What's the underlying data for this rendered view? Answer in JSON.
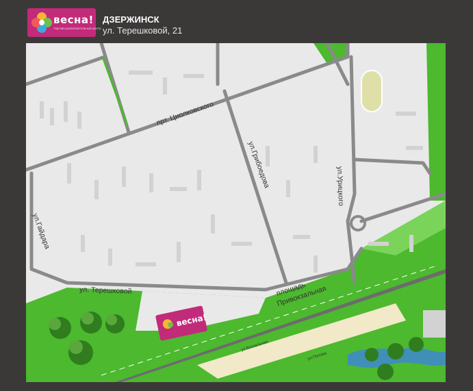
{
  "header": {
    "logo_text": "весна!",
    "logo_subtitle": "торгово-развлекательный центр",
    "city": "ДЗЕРЖИНСК",
    "address": "ул. Терешковой, 21"
  },
  "map": {
    "colors": {
      "block": "#e9e9e9",
      "building": "#d2d2d2",
      "road": "#8a8a8a",
      "green": "#4cb92f",
      "light_green": "#7bd45a",
      "water": "#3f8fb8",
      "railway_area": "#f1e9c8",
      "stadium": "#dfe0a8",
      "brand": "#c22a7a"
    },
    "streets": {
      "tsiolkovskogo": "прт. Циолковского",
      "griboedova": "ул.Грибоедова",
      "uritskogo": "ул.Урицкого",
      "gaidara": "ул.Гайдара",
      "tereshkovoy": "ул. Терешковой",
      "privokzalnaya_1": "площадь",
      "privokzalnaya_2": "Привокзальная",
      "vokzalnaya": "ул.Вокзальная",
      "popova": "ул.Попова"
    },
    "marker_text": "весна!"
  }
}
